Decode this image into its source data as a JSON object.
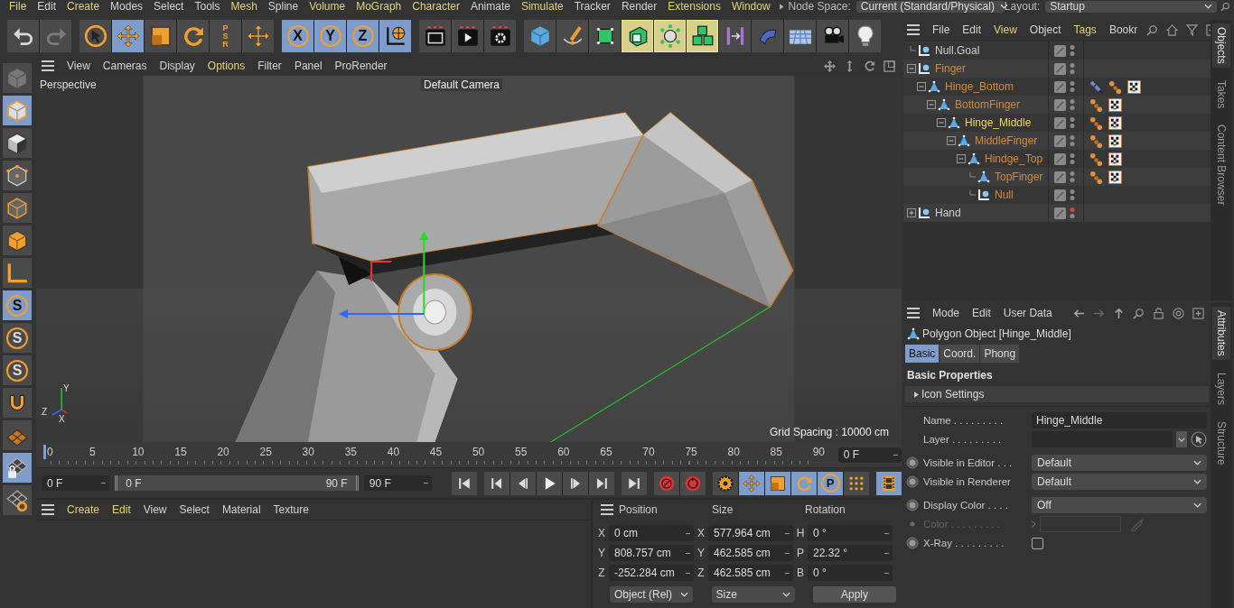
{
  "menubar": {
    "items": [
      {
        "label": "File",
        "accent": true
      },
      {
        "label": "Edit",
        "accent": false
      },
      {
        "label": "Create",
        "accent": true
      },
      {
        "label": "Modes",
        "accent": false
      },
      {
        "label": "Select",
        "accent": false
      },
      {
        "label": "Tools",
        "accent": false
      },
      {
        "label": "Mesh",
        "accent": true
      },
      {
        "label": "Spline",
        "accent": false
      },
      {
        "label": "Volume",
        "accent": true
      },
      {
        "label": "MoGraph",
        "accent": true
      },
      {
        "label": "Character",
        "accent": true
      },
      {
        "label": "Animate",
        "accent": false
      },
      {
        "label": "Simulate",
        "accent": true
      },
      {
        "label": "Tracker",
        "accent": false
      },
      {
        "label": "Render",
        "accent": false
      },
      {
        "label": "Extensions",
        "accent": true
      },
      {
        "label": "Window",
        "accent": true
      }
    ],
    "node_space": {
      "label": "Node Space:",
      "value": "Current (Standard/Physical)"
    },
    "layout": {
      "label": "Layout:",
      "value": "Startup"
    }
  },
  "toolbar": {
    "groups": [
      [
        {
          "selected": false,
          "disabled": false
        },
        {
          "selected": false,
          "disabled": true
        }
      ],
      [
        {
          "selected": false
        },
        {
          "selected": true
        },
        {
          "selected": false
        },
        {
          "selected": false
        },
        {
          "selected": false,
          "label": "P S R"
        },
        {
          "selected": false
        }
      ],
      [
        {
          "selected": true,
          "label": "X"
        },
        {
          "selected": true,
          "label": "Y"
        },
        {
          "selected": true,
          "label": "Z"
        },
        {
          "selected": true
        }
      ],
      [
        {
          "selected": false
        },
        {
          "selected": false
        },
        {
          "selected": false
        }
      ],
      [
        {
          "highlighted": false
        },
        {
          "highlighted": false
        },
        {
          "highlighted": false
        },
        {
          "highlighted": true
        },
        {
          "highlighted": true
        },
        {
          "highlighted": true
        },
        {
          "highlighted": false
        },
        {
          "highlighted": false
        },
        {
          "highlighted": false
        },
        {
          "highlighted": false
        },
        {
          "highlighted": false
        }
      ]
    ]
  },
  "side_toolbar": {
    "items": [
      {
        "selected": false
      },
      {
        "selected": true
      },
      {
        "selected": false
      },
      {
        "selected": false
      },
      {
        "selected": false
      },
      {
        "selected": false
      },
      {
        "selected": false
      },
      {
        "selected": true,
        "label": "S"
      },
      {
        "selected": false,
        "label": "S"
      },
      {
        "selected": false,
        "label": "S"
      },
      {
        "selected": false
      },
      {
        "selected": false
      },
      {
        "selected": true
      },
      {
        "selected": false
      }
    ]
  },
  "viewport": {
    "menu": [
      {
        "label": "View",
        "accent": false
      },
      {
        "label": "Cameras",
        "accent": false
      },
      {
        "label": "Display",
        "accent": false
      },
      {
        "label": "Options",
        "accent": true
      },
      {
        "label": "Filter",
        "accent": false
      },
      {
        "label": "Panel",
        "accent": false
      },
      {
        "label": "ProRender",
        "accent": false
      }
    ],
    "view_name": "Perspective",
    "camera": "Default Camera",
    "grid_spacing": "Grid Spacing : 10000 cm",
    "axis_labels": [
      "Y",
      "Z",
      "X"
    ]
  },
  "timeline": {
    "ticks": [
      {
        "label": "0",
        "current": true
      },
      {
        "label": "5",
        "current": false
      },
      {
        "label": "10",
        "current": false
      },
      {
        "label": "15",
        "current": false
      },
      {
        "label": "20",
        "current": false
      },
      {
        "label": "25",
        "current": false
      },
      {
        "label": "30",
        "current": false
      },
      {
        "label": "35",
        "current": false
      },
      {
        "label": "40",
        "current": false
      },
      {
        "label": "45",
        "current": false
      },
      {
        "label": "50",
        "current": false
      },
      {
        "label": "55",
        "current": false
      },
      {
        "label": "60",
        "current": false
      },
      {
        "label": "65",
        "current": false
      },
      {
        "label": "70",
        "current": false
      },
      {
        "label": "75",
        "current": false
      },
      {
        "label": "80",
        "current": false
      },
      {
        "label": "85",
        "current": false
      },
      {
        "label": "90",
        "current": false
      }
    ],
    "current_frame": "0 F",
    "start": "0 F",
    "range": {
      "start": "0 F",
      "end": "90 F",
      "level": 1
    },
    "end": "90 F",
    "groups": [
      [
        {
          "selected": false
        }
      ],
      [
        {
          "selected": false
        },
        {
          "selected": false
        },
        {
          "selected": false
        },
        {
          "selected": false
        },
        {
          "selected": false
        }
      ],
      [
        {
          "selected": false
        }
      ],
      [
        {
          "selected": false
        },
        {
          "selected": false
        }
      ],
      [
        {
          "selected": false
        },
        {
          "selected": true
        },
        {
          "selected": true
        },
        {
          "selected": true
        },
        {
          "selected": true,
          "label": "P"
        },
        {
          "selected": false
        }
      ],
      [
        {
          "selected": true
        }
      ]
    ]
  },
  "material_manager": {
    "menu": [
      {
        "label": "Create",
        "accent": true
      },
      {
        "label": "Edit",
        "accent": true
      },
      {
        "label": "View",
        "accent": false
      },
      {
        "label": "Select",
        "accent": false
      },
      {
        "label": "Material",
        "accent": false
      },
      {
        "label": "Texture",
        "accent": false
      }
    ]
  },
  "coordinates": {
    "headers": [
      "Position",
      "Size",
      "Rotation"
    ],
    "rows": [
      [
        {
          "axis": "X",
          "value": "0 cm"
        },
        {
          "axis": "X",
          "value": "577.964 cm"
        },
        {
          "axis": "H",
          "value": "0 °"
        }
      ],
      [
        {
          "axis": "Y",
          "value": "808.757 cm"
        },
        {
          "axis": "Y",
          "value": "462.585 cm"
        },
        {
          "axis": "P",
          "value": "22.32 °"
        }
      ],
      [
        {
          "axis": "Z",
          "value": "-252.284 cm"
        },
        {
          "axis": "Z",
          "value": "462.585 cm"
        },
        {
          "axis": "B",
          "value": "0 °"
        }
      ]
    ],
    "mode": "Object (Rel)",
    "size_mode": "Size",
    "apply": "Apply"
  },
  "objects": {
    "menu": [
      {
        "label": "File",
        "accent": false
      },
      {
        "label": "Edit",
        "accent": false
      },
      {
        "label": "View",
        "accent": true
      },
      {
        "label": "Object",
        "accent": false
      },
      {
        "label": "Tags",
        "accent": true
      },
      {
        "label": "Bookr",
        "accent": false
      }
    ],
    "items": [
      {
        "name": "Null.Goal",
        "kind": "null",
        "selected": false,
        "highlighted": false,
        "visible_in_editor": true
      },
      {
        "name": "Finger",
        "kind": "null",
        "selected": false,
        "highlighted": true,
        "visible_in_editor": true,
        "expanded": true,
        "children": [
          {
            "name": "Hinge_Bottom",
            "kind": "polygon",
            "selected": false,
            "highlighted": true,
            "visible_in_editor": true,
            "tags": [
              {
                "kind": "ik"
              },
              {
                "kind": "weights"
              },
              {
                "kind": "texture"
              }
            ],
            "expanded": true,
            "children": [
              {
                "name": "BottomFinger",
                "kind": "polygon",
                "selected": false,
                "highlighted": true,
                "visible_in_editor": true,
                "tags": [
                  {
                    "kind": "weights"
                  },
                  {
                    "kind": "texture"
                  }
                ],
                "expanded": true,
                "children": [
                  {
                    "name": "Hinge_Middle",
                    "kind": "polygon",
                    "selected": true,
                    "highlighted": true,
                    "visible_in_editor": true,
                    "tags": [
                      {
                        "kind": "weights"
                      },
                      {
                        "kind": "texture"
                      }
                    ],
                    "expanded": true,
                    "children": [
                      {
                        "name": "MiddleFinger",
                        "kind": "polygon",
                        "selected": false,
                        "highlighted": true,
                        "visible_in_editor": true,
                        "tags": [
                          {
                            "kind": "weights"
                          },
                          {
                            "kind": "texture"
                          }
                        ],
                        "expanded": true,
                        "children": [
                          {
                            "name": "Hindge_Top",
                            "kind": "polygon",
                            "selected": false,
                            "highlighted": true,
                            "visible_in_editor": true,
                            "tags": [
                              {
                                "kind": "weights"
                              },
                              {
                                "kind": "texture"
                              }
                            ],
                            "expanded": true,
                            "children": [
                              {
                                "name": "TopFinger",
                                "kind": "polygon",
                                "selected": false,
                                "highlighted": true,
                                "visible_in_editor": true,
                                "tags": [
                                  {
                                    "kind": "weights"
                                  },
                                  {
                                    "kind": "texture"
                                  }
                                ]
                              },
                              {
                                "name": "Null",
                                "kind": "null",
                                "selected": false,
                                "highlighted": true,
                                "visible_in_editor": true
                              }
                            ]
                          }
                        ]
                      }
                    ]
                  }
                ]
              }
            ]
          }
        ]
      },
      {
        "name": "Hand",
        "kind": "null",
        "selected": false,
        "highlighted": false,
        "visible_in_editor": false,
        "expanded": false
      }
    ],
    "tabs": [
      {
        "label": "Objects",
        "selected": true
      },
      {
        "label": "Takes",
        "selected": false
      },
      {
        "label": "Content Browser",
        "selected": false
      }
    ]
  },
  "attributes": {
    "menu": [
      {
        "label": "Mode",
        "accent": false
      },
      {
        "label": "Edit",
        "accent": false
      },
      {
        "label": "User Data",
        "accent": false
      }
    ],
    "title": "Polygon Object [Hinge_Middle]",
    "tabs": [
      {
        "label": "Basic",
        "selected": true
      },
      {
        "label": "Coord.",
        "selected": false
      },
      {
        "label": "Phong",
        "selected": false
      }
    ],
    "section": "Basic Properties",
    "group": {
      "label": "Icon Settings",
      "expanded": false
    },
    "fields": [
      {
        "kind": "text",
        "label": "Name . . . . . . . . .",
        "value": "Hinge_Middle",
        "animatable": false,
        "disabled": false
      },
      {
        "kind": "layer",
        "label": "Layer . . . . . . . . .",
        "animatable": false,
        "disabled": false
      },
      {
        "kind": "dropdown",
        "label": "Visible in Editor . . .",
        "value": "Default",
        "animatable": true,
        "disabled": false
      },
      {
        "kind": "dropdown",
        "label": "Visible in Renderer",
        "value": "Default",
        "animatable": true,
        "disabled": false
      },
      {
        "kind": "dropdown",
        "label": "Display Color . . . .",
        "value": "Off",
        "animatable": true,
        "disabled": false
      },
      {
        "kind": "color",
        "label": "Color . . . . . . . . .",
        "animatable": true,
        "disabled": true
      },
      {
        "kind": "checkbox",
        "label": "X-Ray . . . . . . . . .",
        "checked": false,
        "animatable": true,
        "disabled": false
      }
    ],
    "tabs_side": [
      {
        "label": "Attributes",
        "selected": true
      },
      {
        "label": "Layers",
        "selected": false
      },
      {
        "label": "Structure",
        "selected": false
      }
    ]
  }
}
